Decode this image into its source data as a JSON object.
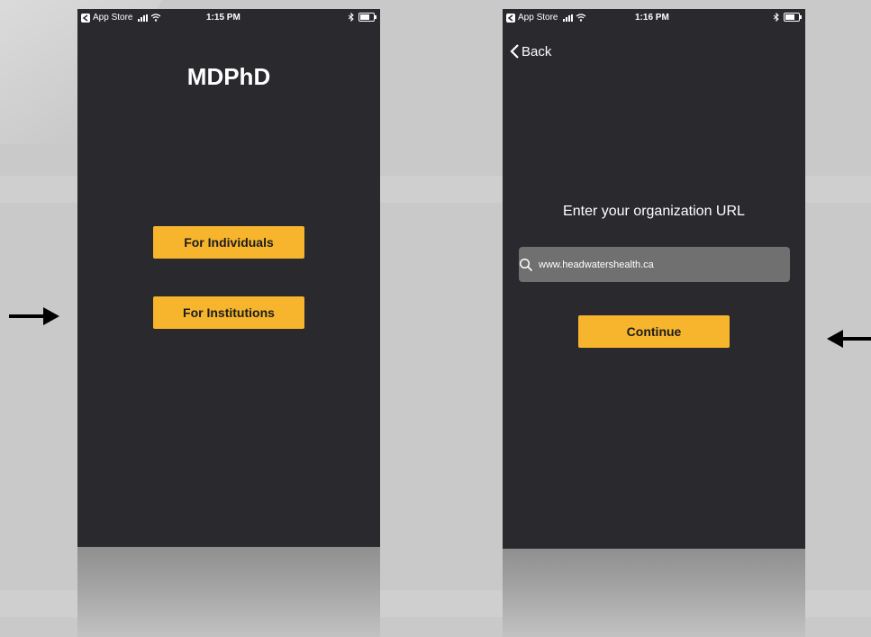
{
  "screen_left": {
    "status_bar": {
      "back_app": "App Store",
      "time": "1:15 PM"
    },
    "app_title": "MDPhD",
    "buttons": {
      "individuals": "For Individuals",
      "institutions": "For Institutions"
    }
  },
  "screen_right": {
    "status_bar": {
      "back_app": "App Store",
      "time": "1:16 PM"
    },
    "nav": {
      "back_label": "Back"
    },
    "prompt": "Enter your organization URL",
    "url_field": {
      "value": "www.headwatershealth.ca"
    },
    "continue_label": "Continue"
  },
  "colors": {
    "accent": "#f6b52c",
    "screen_bg": "#2a292e",
    "backdrop": "#c9c9c9",
    "field_bg": "#707070"
  },
  "icons": [
    "app-store-icon",
    "signal-icon",
    "wifi-icon",
    "bluetooth-icon",
    "battery-icon",
    "chevron-left-icon",
    "search-icon",
    "arrow-right-icon",
    "arrow-left-icon"
  ]
}
